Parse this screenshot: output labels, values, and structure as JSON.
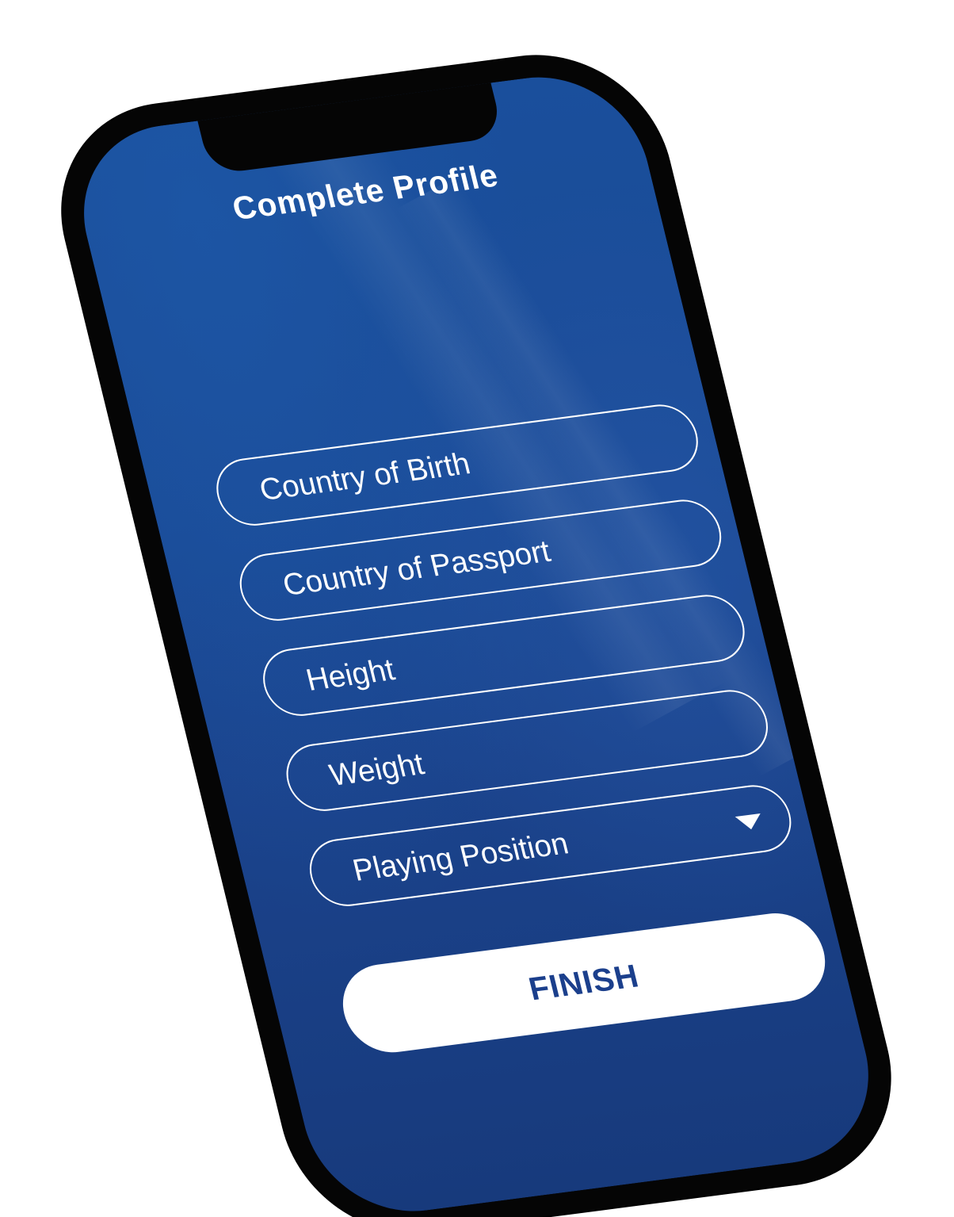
{
  "screen": {
    "title": "Complete Profile"
  },
  "form": {
    "fields": [
      {
        "placeholder": "Country of Birth"
      },
      {
        "placeholder": "Country of Passport"
      },
      {
        "placeholder": "Height"
      },
      {
        "placeholder": "Weight"
      },
      {
        "placeholder": "Playing Position"
      }
    ],
    "finish_label": "FINISH"
  },
  "colors": {
    "screen_background": "#1a4a96",
    "field_border": "#ffffff",
    "button_background": "#ffffff",
    "button_text": "#1b3f8c",
    "frame": "#050505"
  },
  "icons": {
    "dropdown": "dropdown-triangle-icon"
  }
}
